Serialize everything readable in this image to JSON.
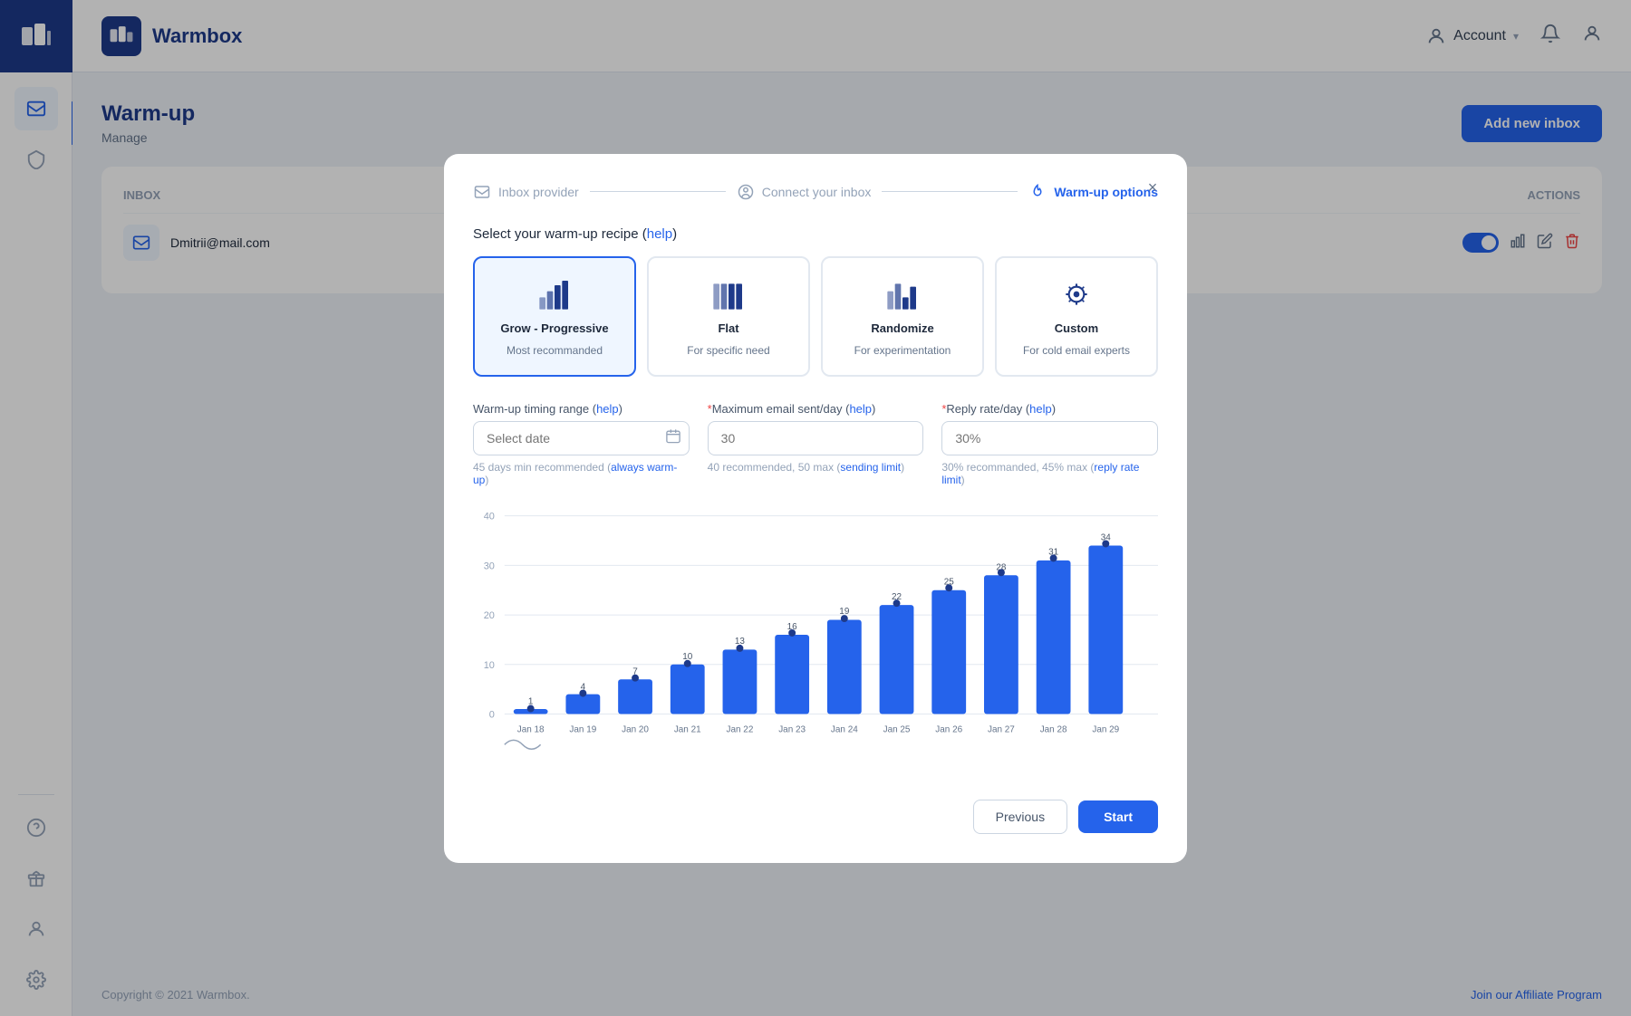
{
  "brand": {
    "name": "Warmbox"
  },
  "sidebar": {
    "items": [
      {
        "name": "inbox",
        "icon": "inbox-icon",
        "active": true
      },
      {
        "name": "shield",
        "icon": "shield-icon",
        "active": false
      }
    ],
    "bottom_items": [
      {
        "name": "help",
        "icon": "help-icon"
      },
      {
        "name": "gift",
        "icon": "gift-icon"
      },
      {
        "name": "user",
        "icon": "user-icon"
      },
      {
        "name": "settings",
        "icon": "settings-icon"
      }
    ]
  },
  "topbar": {
    "account_label": "Account",
    "account_chevron": "▾"
  },
  "page": {
    "title": "Warm-up",
    "subtitle": "Manage",
    "add_button": "Add new inbox",
    "inbox_col": "Inbox",
    "actions_col": "Actions"
  },
  "inbox_rows": [
    {
      "email": "Dmitrii@mail.com"
    }
  ],
  "footer": {
    "copyright": "Copyright © 2021 Warmbox.",
    "affiliate_link": "Join our Affiliate Program"
  },
  "modal": {
    "close": "×",
    "steps": [
      {
        "label": "Inbox provider",
        "icon": "mail-icon",
        "active": false
      },
      {
        "label": "Connect your inbox",
        "icon": "user-circle-icon",
        "active": false
      },
      {
        "label": "Warm-up options",
        "icon": "flame-icon",
        "active": true
      }
    ],
    "section_title": "Select your warm-up recipe",
    "help_link": "help",
    "recipes": [
      {
        "name": "Grow - Progressive",
        "desc": "Most recommanded",
        "selected": true,
        "icon": "grow-icon"
      },
      {
        "name": "Flat",
        "desc": "For specific need",
        "selected": false,
        "icon": "flat-icon"
      },
      {
        "name": "Randomize",
        "desc": "For experimentation",
        "selected": false,
        "icon": "randomize-icon"
      },
      {
        "name": "Custom",
        "desc": "For cold email experts",
        "selected": false,
        "icon": "custom-icon"
      }
    ],
    "timing_label": "Warm-up timing range",
    "timing_help": "help",
    "timing_placeholder": "Select date",
    "timing_hint": "45 days min recommended",
    "timing_hint_link": "always warm-up",
    "max_email_label": "Maximum email sent/day",
    "max_email_help": "help",
    "max_email_placeholder": "30",
    "max_email_hint": "40 recommended, 50 max",
    "max_email_hint_link": "sending limit",
    "reply_rate_label": "Reply rate/day",
    "reply_rate_help": "help",
    "reply_rate_placeholder": "30%",
    "reply_rate_hint": "30% recommanded, 45% max",
    "reply_rate_hint_link": "reply rate limit",
    "chart": {
      "y_labels": [
        40,
        30,
        20,
        10,
        0
      ],
      "bars": [
        {
          "date": "Jan 18",
          "value": 1,
          "dot": 1
        },
        {
          "date": "Jan 19",
          "value": 4,
          "dot": 4
        },
        {
          "date": "Jan 20",
          "value": 7,
          "dot": 7
        },
        {
          "date": "Jan 21",
          "value": 10,
          "dot": 10
        },
        {
          "date": "Jan 22",
          "value": 13,
          "dot": 13
        },
        {
          "date": "Jan 23",
          "value": 16,
          "dot": 16
        },
        {
          "date": "Jan 24",
          "value": 19,
          "dot": 19
        },
        {
          "date": "Jan 25",
          "value": 22,
          "dot": 22
        },
        {
          "date": "Jan 26",
          "value": 25,
          "dot": 25
        },
        {
          "date": "Jan 27",
          "value": 28,
          "dot": 28
        },
        {
          "date": "Jan 28",
          "value": 31,
          "dot": 31
        },
        {
          "date": "Jan 29",
          "value": 34,
          "dot": 34
        }
      ],
      "max_value": 40
    },
    "prev_button": "Previous",
    "start_button": "Start"
  }
}
